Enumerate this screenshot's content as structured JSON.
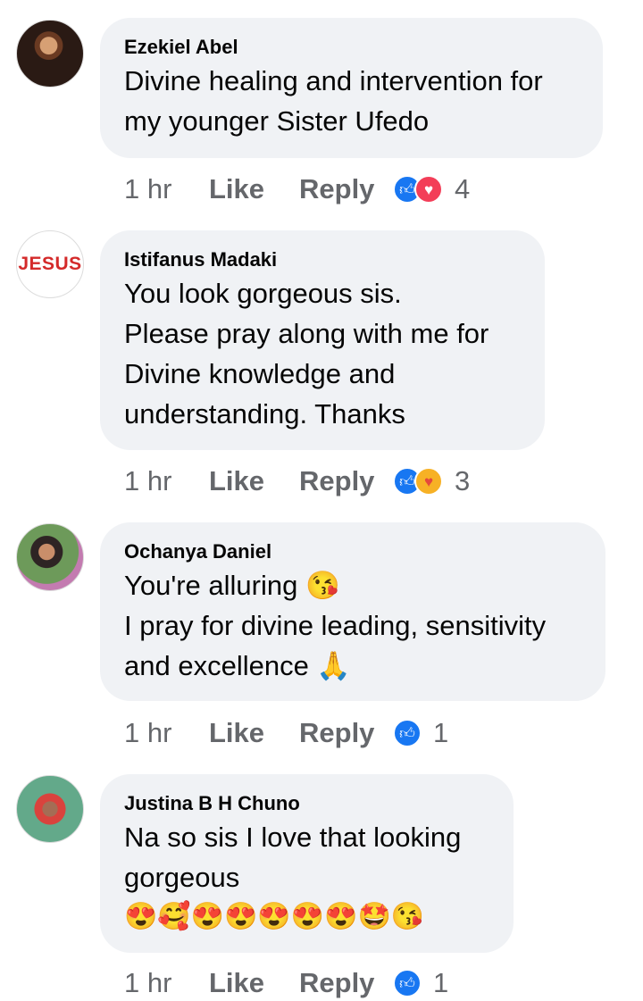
{
  "comments": [
    {
      "author": "Ezekiel Abel",
      "avatar": {
        "type": "photo"
      },
      "lines": [
        "Divine healing and intervention for",
        "my younger Sister Ufedo"
      ],
      "emoji_line": "",
      "time": "1 hr",
      "like_label": "Like",
      "reply_label": "Reply",
      "reactions": [
        "like",
        "love"
      ],
      "reaction_count": "4"
    },
    {
      "author": "Istifanus Madaki",
      "avatar": {
        "type": "logo",
        "text": "JESUS",
        "color": "#d42a2a"
      },
      "lines": [
        "You look gorgeous sis.",
        "Please pray along with me for",
        "Divine knowledge and",
        "understanding. Thanks"
      ],
      "emoji_line": "",
      "time": "1 hr",
      "like_label": "Like",
      "reply_label": "Reply",
      "reactions": [
        "like",
        "care"
      ],
      "reaction_count": "3"
    },
    {
      "author": "Ochanya Daniel",
      "avatar": {
        "type": "photo"
      },
      "lines": [
        "You're alluring 😘",
        "I pray for divine leading, sensitivity",
        "and excellence 🙏"
      ],
      "emoji_line": "",
      "time": "1 hr",
      "like_label": "Like",
      "reply_label": "Reply",
      "reactions": [
        "like"
      ],
      "reaction_count": "1"
    },
    {
      "author": "Justina B H Chuno",
      "avatar": {
        "type": "photo"
      },
      "lines": [
        "Na so sis I love that looking",
        "gorgeous"
      ],
      "emoji_line": "😍🥰😍😍😍😍😍🤩😘",
      "time": "1 hr",
      "like_label": "Like",
      "reply_label": "Reply",
      "reactions": [
        "like"
      ],
      "reaction_count": "1"
    }
  ],
  "icons": {
    "like": "thumbs-up-icon",
    "love": "heart-icon",
    "care": "hug-face-icon"
  },
  "colors": {
    "bubble": "#f0f2f5",
    "like": "#1877f2",
    "love": "#f33e58",
    "care": "#f7b125",
    "meta_text": "#65676b",
    "logo_red": "#d42a2a"
  }
}
